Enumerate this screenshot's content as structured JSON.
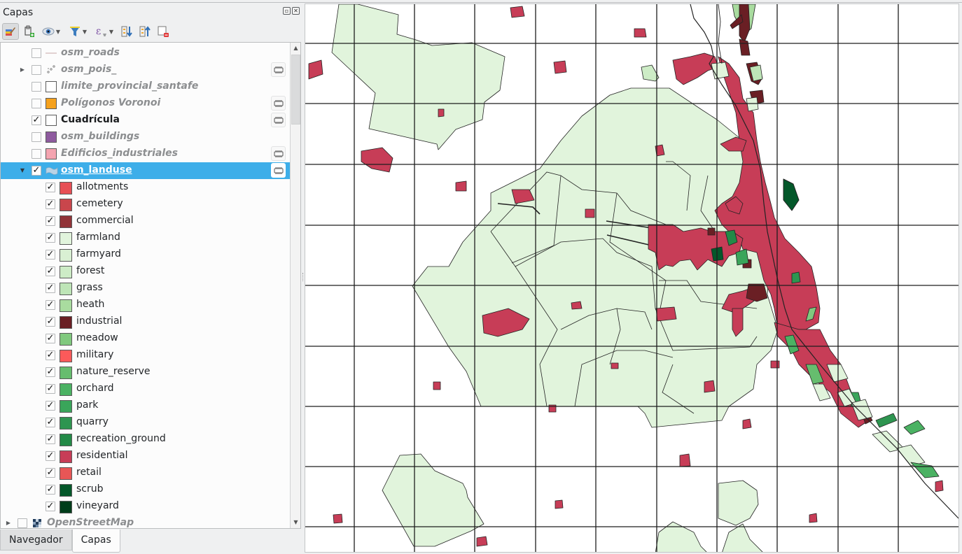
{
  "panel": {
    "title": "Capas",
    "title_buttons": [
      "float-icon",
      "close-icon"
    ],
    "toolbar": [
      {
        "icon": "style-manager-icon",
        "tooltip": "Styling",
        "active": true
      },
      {
        "icon": "add-group-icon"
      },
      {
        "icon": "visibility-icon",
        "menu": true
      },
      {
        "icon": "filter-legend-icon",
        "menu": true
      },
      {
        "icon": "expression-filter-icon",
        "menu": true
      },
      {
        "icon": "expand-all-icon"
      },
      {
        "icon": "collapse-all-icon"
      },
      {
        "icon": "remove-layer-icon"
      }
    ],
    "layers": [
      {
        "name": "osm_roads",
        "checked": false,
        "symbol": "line",
        "color": "#d9c3c3",
        "expandable": false,
        "temporary": false
      },
      {
        "name": "osm_pois_",
        "checked": false,
        "symbol": "points",
        "color": "#8c8e90",
        "expandable": true,
        "expanded": false,
        "temporary": true
      },
      {
        "name": "limite_provincial_santafe",
        "checked": false,
        "symbol": "fill",
        "color": "#ffffff",
        "expandable": false,
        "temporary": false
      },
      {
        "name": "Polígonos Voronoi",
        "checked": false,
        "symbol": "fill",
        "color": "#f5a11d",
        "expandable": false,
        "temporary": true
      },
      {
        "name": "Cuadrícula",
        "checked": true,
        "symbol": "fill",
        "color": "#ffffff",
        "expandable": false,
        "temporary": true
      },
      {
        "name": "osm_buildings",
        "checked": false,
        "symbol": "fill",
        "color": "#8e5a9e",
        "expandable": false,
        "temporary": false
      },
      {
        "name": "Edificios_industriales",
        "checked": false,
        "symbol": "fill",
        "color": "#f4a4b0",
        "expandable": false,
        "temporary": true
      },
      {
        "name": "osm_landuse",
        "checked": true,
        "symbol": "categorized",
        "selected": true,
        "expandable": true,
        "expanded": true,
        "temporary": true,
        "classes": [
          {
            "label": "allotments",
            "checked": true,
            "color": "#e74f55"
          },
          {
            "label": "cemetery",
            "checked": true,
            "color": "#c9464c"
          },
          {
            "label": "commercial",
            "checked": true,
            "color": "#913338"
          },
          {
            "label": "farmland",
            "checked": true,
            "color": "#e1f4dc"
          },
          {
            "label": "farmyard",
            "checked": true,
            "color": "#d9f0d3"
          },
          {
            "label": "forest",
            "checked": true,
            "color": "#cdecc6"
          },
          {
            "label": "grass",
            "checked": true,
            "color": "#bee5b7"
          },
          {
            "label": "heath",
            "checked": true,
            "color": "#a9dc9f"
          },
          {
            "label": "industrial",
            "checked": true,
            "color": "#6a1f24"
          },
          {
            "label": "meadow",
            "checked": true,
            "color": "#80c97e"
          },
          {
            "label": "military",
            "checked": true,
            "color": "#fb5a5a"
          },
          {
            "label": "nature_reserve",
            "checked": true,
            "color": "#66bd6e"
          },
          {
            "label": "orchard",
            "checked": true,
            "color": "#4bb263"
          },
          {
            "label": "park",
            "checked": true,
            "color": "#3aa55a"
          },
          {
            "label": "quarry",
            "checked": true,
            "color": "#2e9550"
          },
          {
            "label": "recreation_ground",
            "checked": true,
            "color": "#238a47"
          },
          {
            "label": "residential",
            "checked": true,
            "color": "#c73d57"
          },
          {
            "label": "retail",
            "checked": true,
            "color": "#e85656"
          },
          {
            "label": "scrub",
            "checked": true,
            "color": "#04582a"
          },
          {
            "label": "vineyard",
            "checked": true,
            "color": "#003d1a"
          }
        ]
      },
      {
        "name": "OpenStreetMap",
        "checked": false,
        "symbol": "raster",
        "expandable": true,
        "expanded": false,
        "temporary": false
      }
    ]
  },
  "tabs": [
    {
      "label": "Navegador",
      "active": false
    },
    {
      "label": "Capas",
      "active": true
    }
  ],
  "map": {
    "grid_color": "#1e1e1e",
    "background": "#ffffff",
    "stroke": "#232323"
  }
}
